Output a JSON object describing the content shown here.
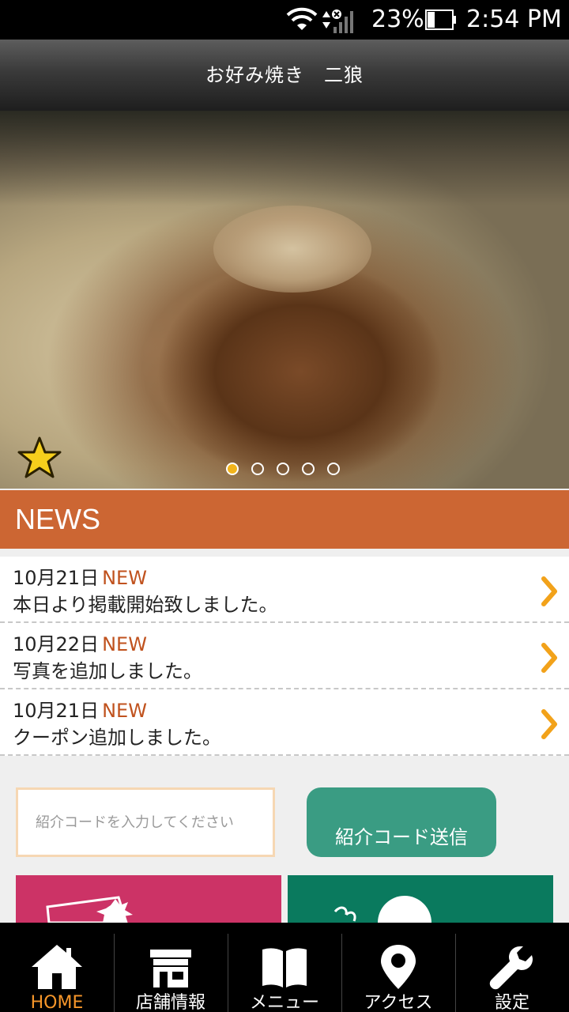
{
  "status_bar": {
    "battery_percent": "23%",
    "time": "2:54 PM"
  },
  "app_bar": {
    "title": "お好み焼き　二狼"
  },
  "hero": {
    "slide_count": 5,
    "active_slide": 1
  },
  "news": {
    "header": "NEWS",
    "items": [
      {
        "date": "10月21日",
        "badge": "NEW",
        "text": "本日より掲載開始致しました。"
      },
      {
        "date": "10月22日",
        "badge": "NEW",
        "text": "写真を追加しました。"
      },
      {
        "date": "10月21日",
        "badge": "NEW",
        "text": "クーポン追加しました。"
      }
    ]
  },
  "referral": {
    "placeholder": "紹介コードを入力してください",
    "submit_label": "紹介コード送信"
  },
  "bottom_nav": {
    "items": [
      {
        "label": "HOME",
        "icon": "home-icon",
        "active": true
      },
      {
        "label": "店舗情報",
        "icon": "store-icon",
        "active": false
      },
      {
        "label": "メニュー",
        "icon": "book-icon",
        "active": false
      },
      {
        "label": "アクセス",
        "icon": "map-pin-icon",
        "active": false
      },
      {
        "label": "設定",
        "icon": "wrench-icon",
        "active": false
      }
    ]
  },
  "colors": {
    "news_header": "#cc6633",
    "new_badge": "#c0521e",
    "chevron": "#f2a21a",
    "referral_button": "#3a9c83",
    "coupon_tile": "#cc3366",
    "stamp_tile": "#0a7a5e",
    "nav_active": "#f6962a"
  }
}
